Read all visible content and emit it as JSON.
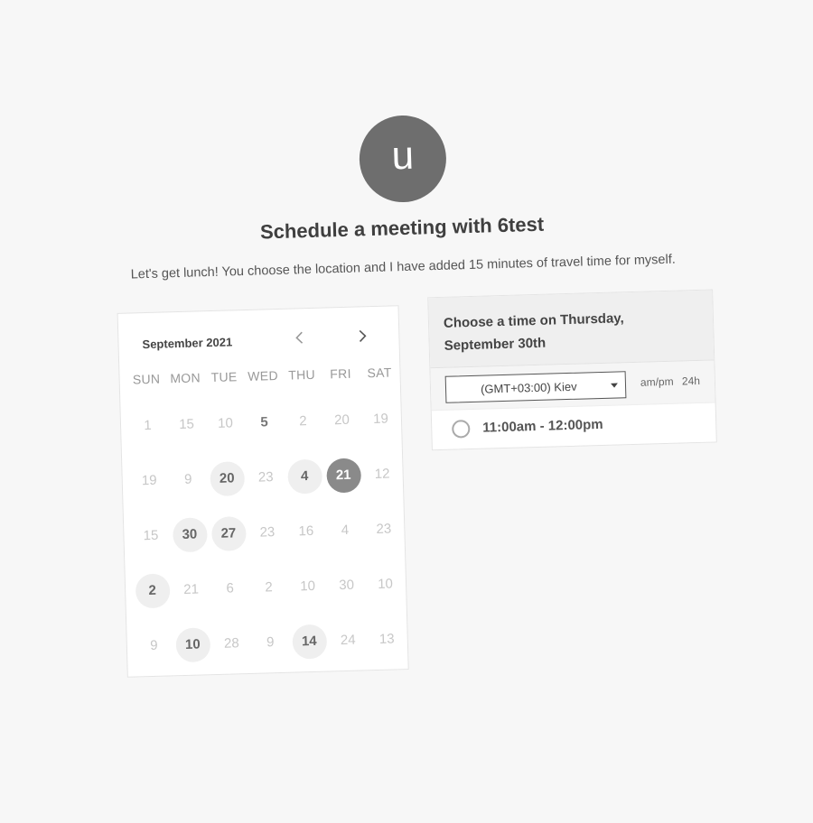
{
  "profile": {
    "avatar_letter": "u"
  },
  "header": {
    "title": "Schedule a meeting with 6test",
    "subtitle": "Let's get lunch! You choose the location and I have added 15 minutes of travel time for myself."
  },
  "calendar": {
    "month_label": "September 2021",
    "prev_icon": "chevron-left-icon",
    "next_icon": "chevron-right-icon",
    "weekdays": [
      "SUN",
      "MON",
      "TUE",
      "WED",
      "THU",
      "FRI",
      "SAT"
    ],
    "weeks": [
      [
        {
          "d": "1"
        },
        {
          "d": "15"
        },
        {
          "d": "10"
        },
        {
          "d": "5",
          "s": "bold"
        },
        {
          "d": "2"
        },
        {
          "d": "20"
        },
        {
          "d": "19"
        }
      ],
      [
        {
          "d": "19"
        },
        {
          "d": "9"
        },
        {
          "d": "20",
          "s": "available"
        },
        {
          "d": "23"
        },
        {
          "d": "4",
          "s": "available"
        },
        {
          "d": "21",
          "s": "selected"
        },
        {
          "d": "12"
        }
      ],
      [
        {
          "d": "15"
        },
        {
          "d": "30",
          "s": "available"
        },
        {
          "d": "27",
          "s": "available"
        },
        {
          "d": "23"
        },
        {
          "d": "16"
        },
        {
          "d": "4"
        },
        {
          "d": "23"
        }
      ],
      [
        {
          "d": "2",
          "s": "available"
        },
        {
          "d": "21"
        },
        {
          "d": "6"
        },
        {
          "d": "2"
        },
        {
          "d": "10"
        },
        {
          "d": "30"
        },
        {
          "d": "10"
        }
      ],
      [
        {
          "d": "9"
        },
        {
          "d": "10",
          "s": "available"
        },
        {
          "d": "28"
        },
        {
          "d": "9"
        },
        {
          "d": "14",
          "s": "available"
        },
        {
          "d": "24"
        },
        {
          "d": "13"
        }
      ]
    ]
  },
  "times": {
    "heading_line1": "Choose a time on Thursday,",
    "heading_line2": "September 30th",
    "timezone": "(GMT+03:00) Kiev",
    "format_ampm": "am/pm",
    "format_24h": "24h",
    "slots": [
      "11:00am - 12:00pm"
    ]
  },
  "colors": {
    "background": "#f7f7f7",
    "avatar": "#6e6e6e",
    "selected_day": "#8a8a8a",
    "available_day": "#efefef"
  }
}
